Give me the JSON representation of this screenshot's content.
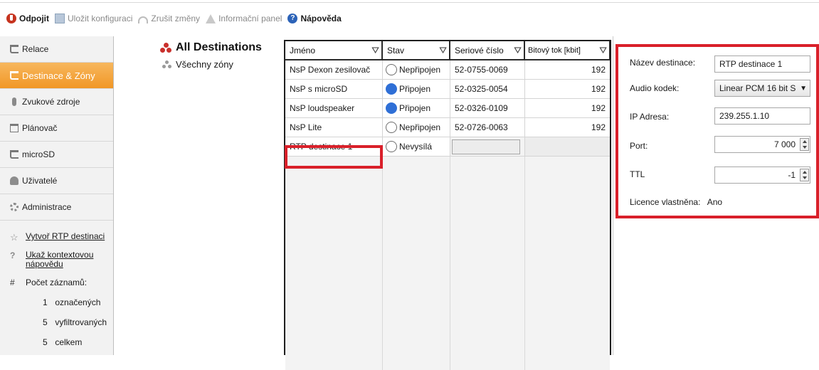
{
  "toolbar": {
    "disconnect": "Odpojit",
    "save": "Uložit konfiguraci",
    "undo": "Zrušit změny",
    "info": "Informační panel",
    "help": "Nápověda"
  },
  "nav": {
    "items": [
      {
        "label": "Relace",
        "icon": "note-icon"
      },
      {
        "label": "Destinace & Zóny",
        "icon": "note-icon",
        "active": true
      },
      {
        "label": "Zvukové zdroje",
        "icon": "mic-icon"
      },
      {
        "label": "Plánovač",
        "icon": "calendar-icon"
      },
      {
        "label": "microSD",
        "icon": "note-icon"
      },
      {
        "label": "Uživatelé",
        "icon": "users-icon"
      },
      {
        "label": "Administrace",
        "icon": "gear-icon"
      }
    ],
    "actions": {
      "create_rtp": "Vytvoř RTP destinaci",
      "help_line1": "Ukaž kontextovou",
      "help_line2": "nápovědu"
    },
    "counts": {
      "symbol": "#",
      "title": "Počet záznamů:",
      "marked_num": "1",
      "marked_label": "označených",
      "filtered_num": "5",
      "filtered_label": "vyfiltrovaných",
      "total_num": "5",
      "total_label": "celkem"
    }
  },
  "tree": {
    "root": "All Destinations",
    "child": "Všechny zóny"
  },
  "table": {
    "headers": [
      "Jméno",
      "Stav",
      "Seriové číslo",
      "Bitový tok [kbit]"
    ],
    "rows": [
      {
        "name": "NsP Dexon zesilovač",
        "status": "Nepřipojen",
        "connected": false,
        "serial": "52-0755-0069",
        "bitrate": "192"
      },
      {
        "name": "NsP s microSD",
        "status": "Připojen",
        "connected": true,
        "serial": "52-0325-0054",
        "bitrate": "192"
      },
      {
        "name": "NsP loudspeaker",
        "status": "Připojen",
        "connected": true,
        "serial": "52-0326-0109",
        "bitrate": "192"
      },
      {
        "name": "NsP Lite",
        "status": "Nepřipojen",
        "connected": false,
        "serial": "52-0726-0063",
        "bitrate": "192"
      },
      {
        "name": "RTP destinace 1",
        "status": "Nevysílá",
        "connected": false,
        "serial": "",
        "bitrate": ""
      }
    ]
  },
  "detail": {
    "name_label": "Název destinace:",
    "name_value": "RTP destinace 1",
    "codec_label": "Audio kodek:",
    "codec_value": "Linear PCM 16 bit S",
    "ip_label": "IP Adresa:",
    "ip_value": "239.255.1.10",
    "port_label": "Port:",
    "port_value": "7 000",
    "ttl_label": "TTL",
    "ttl_value": "-1",
    "license_label": "Licence vlastněna:",
    "license_value": "Ano"
  },
  "colors": {
    "accent_orange": "#f19726",
    "highlight_red": "#d9202a",
    "connected_blue": "#2f6fd6",
    "dot_red": "#c9302c",
    "dot_gray": "#9a9a9a"
  }
}
